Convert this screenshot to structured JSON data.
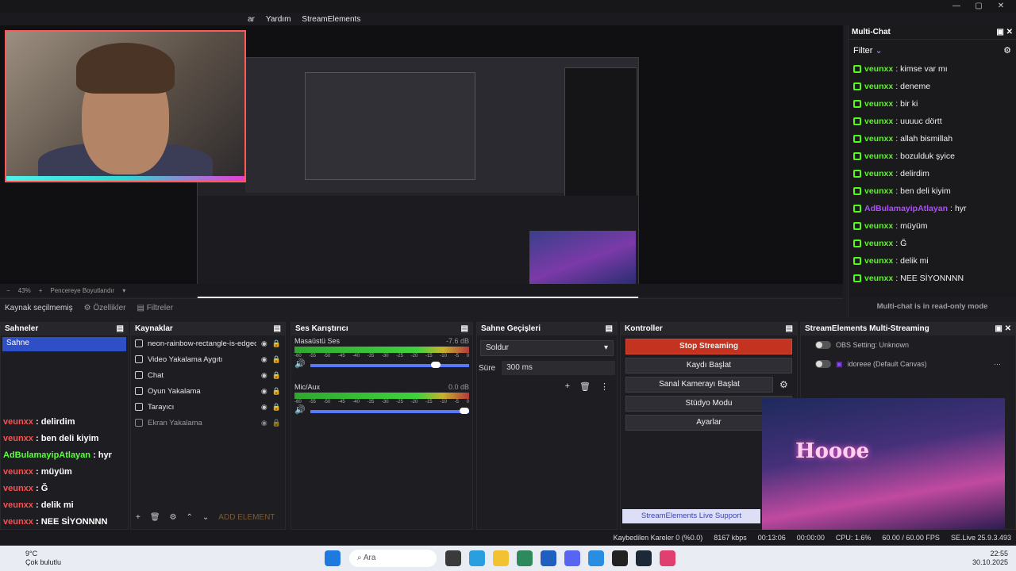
{
  "menu": {
    "items": [
      "ar",
      "Yardım",
      "StreamElements"
    ]
  },
  "zoom": {
    "level": "43%",
    "fit_label": "Pencereye Boyutlandır"
  },
  "source_bar": {
    "status": "Kaynak seçilmemiş",
    "properties": "Özellikler",
    "filters": "Filtreler"
  },
  "multichat": {
    "title": "Multi-Chat",
    "filter_label": "Filter",
    "footer": "Multi-chat is in read-only mode",
    "messages": [
      {
        "user": "veunxx",
        "text": "kimse var mı",
        "color": "#53fc18"
      },
      {
        "user": "veunxx",
        "text": "deneme",
        "color": "#53fc18"
      },
      {
        "user": "veunxx",
        "text": "bir ki",
        "color": "#53fc18"
      },
      {
        "user": "veunxx",
        "text": "uuuuc dörtt",
        "color": "#53fc18"
      },
      {
        "user": "veunxx",
        "text": "allah bismillah",
        "color": "#53fc18"
      },
      {
        "user": "veunxx",
        "text": "bozulduk şyice",
        "color": "#53fc18"
      },
      {
        "user": "veunxx",
        "text": "delirdim",
        "color": "#53fc18"
      },
      {
        "user": "veunxx",
        "text": "ben deli kiyim",
        "color": "#53fc18"
      },
      {
        "user": "AdBulamayipAtlayan",
        "text": "hyr",
        "color": "#b04dff"
      },
      {
        "user": "veunxx",
        "text": "müyüm",
        "color": "#53fc18"
      },
      {
        "user": "veunxx",
        "text": "Ğ",
        "color": "#53fc18"
      },
      {
        "user": "veunxx",
        "text": "delik mi",
        "color": "#53fc18"
      },
      {
        "user": "veunxx",
        "text": "NEE SİYONNNN",
        "color": "#53fc18"
      }
    ]
  },
  "scenes": {
    "title": "Sahneler",
    "items": [
      "Sahne"
    ]
  },
  "sources": {
    "title": "Kaynaklar",
    "items": [
      "neon-rainbow-rectangle-is-edged-v",
      "Video Yakalama Aygıtı",
      "Chat",
      "Oyun Yakalama",
      "Tarayıcı",
      "Ekran Yakalama"
    ],
    "add_element": "ADD ELEMENT"
  },
  "chat_overlay": [
    {
      "user": "veunxx",
      "text": " : delirdim"
    },
    {
      "user": "veunxx",
      "text": " : ben deli kiyim"
    },
    {
      "user": "AdBulamayipAtlayan",
      "text": " : hyr"
    },
    {
      "user": "veunxx",
      "text": " : müyüm"
    },
    {
      "user": "veunxx",
      "text": " : Ğ"
    },
    {
      "user": "veunxx",
      "text": " : delik mi"
    },
    {
      "user": "veunxx",
      "text": " : NEE SİYONNNN"
    }
  ],
  "mixer": {
    "title": "Ses Karıştırıcı",
    "channels": [
      {
        "name": "Masaüstü Ses",
        "db": "-7.6 dB",
        "volume": 0.82
      },
      {
        "name": "Mic/Aux",
        "db": "0.0 dB",
        "volume": 1.0
      }
    ],
    "ticks": [
      "-60",
      "-55",
      "-50",
      "-45",
      "-40",
      "-35",
      "-30",
      "-25",
      "-20",
      "-15",
      "-10",
      "-5",
      "0"
    ]
  },
  "transitions": {
    "title": "Sahne Geçişleri",
    "selected": "Soldur",
    "duration_label": "Süre",
    "duration": "300 ms"
  },
  "controls": {
    "title": "Kontroller",
    "buttons": [
      "Stop Streaming",
      "Kaydı Başlat",
      "Sanal Kamerayı Başlat",
      "Stüdyo Modu",
      "Ayarlar"
    ]
  },
  "se": {
    "title": "StreamElements Multi-Streaming",
    "row1": "OBS Setting: Unknown",
    "row2": "idoreee (Default Canvas)",
    "support": "StreamElements Live Support",
    "art_text": "Hoooe"
  },
  "status": {
    "dropped": "Kaybedilen Kareler 0 (%0.0)",
    "bitrate": "8167 kbps",
    "stream_time": "00:13:06",
    "rec_time": "00:00:00",
    "cpu": "CPU: 1.6%",
    "fps": "60.00 / 60.00 FPS",
    "version": "SE.Live 25.9.3.493"
  },
  "taskbar": {
    "weather_temp": "9°C",
    "weather_desc": "Çok bulutlu",
    "search": "Ara",
    "time": "22:55",
    "date": "30.10.2025"
  }
}
